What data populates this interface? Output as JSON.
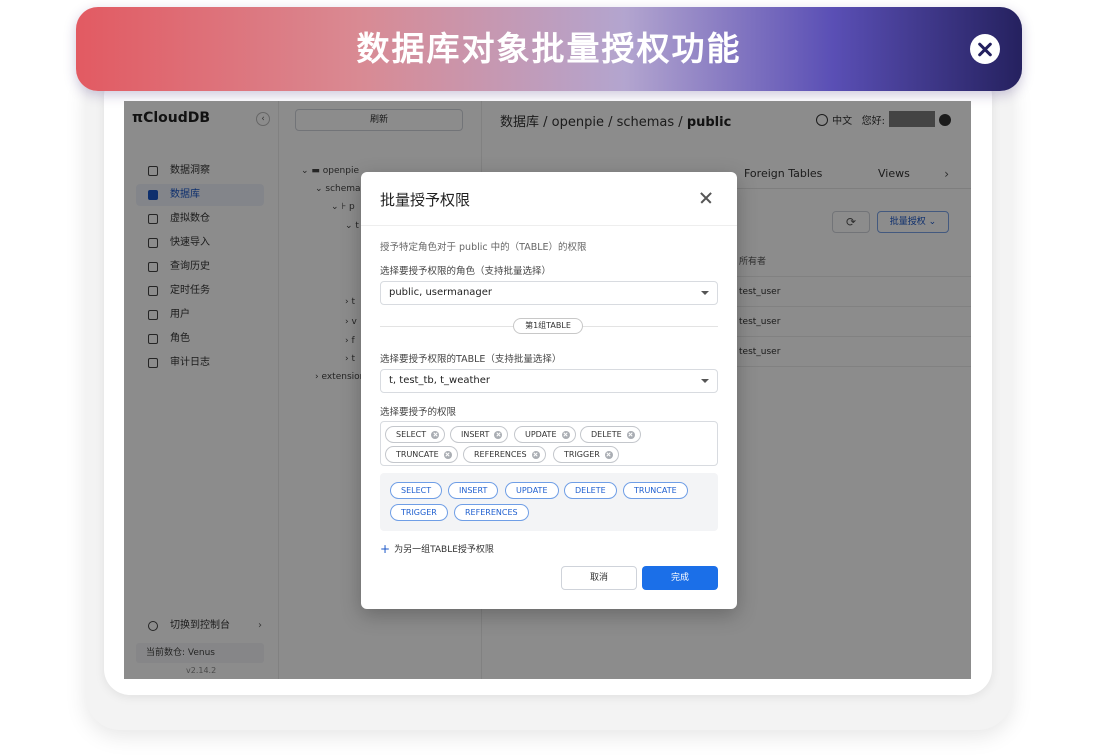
{
  "banner": {
    "title": "数据库对象批量授权功能"
  },
  "app": {
    "logo": "π",
    "logo_text": "CloudDB",
    "sidebar": {
      "items": [
        {
          "label": "数据洞察",
          "icon": "insight-icon"
        },
        {
          "label": "数据库",
          "icon": "database-icon"
        },
        {
          "label": "虚拟数仓",
          "icon": "warehouse-icon"
        },
        {
          "label": "快速导入",
          "icon": "upload-icon"
        },
        {
          "label": "查询历史",
          "icon": "history-icon"
        },
        {
          "label": "定时任务",
          "icon": "calendar-icon"
        },
        {
          "label": "用户",
          "icon": "user-icon"
        },
        {
          "label": "角色",
          "icon": "role-icon"
        },
        {
          "label": "审计日志",
          "icon": "audit-icon"
        }
      ],
      "switch_console": "切换到控制台",
      "current_warehouse": "当前数仓: Venus",
      "version": "v2.14.2"
    },
    "tree": {
      "refresh_label": "刷新",
      "rows": [
        "openpie",
        "schemas",
        "p",
        "t",
        "t",
        "v",
        "f",
        "t",
        "extensions"
      ]
    },
    "header": {
      "breadcrumb_1": "数据库 / openpie / schemas / ",
      "breadcrumb_current": "public",
      "language": "中文",
      "greeting": "您好:"
    },
    "tabs": [
      "Foreign Tables",
      "Views"
    ],
    "toolbar": {
      "batch_grant": "批量授权"
    },
    "table": {
      "owner_header": "所有者",
      "owners": [
        "test_user",
        "test_user",
        "test_user"
      ]
    }
  },
  "modal": {
    "title": "批量授予权限",
    "subtitle": "授予特定角色对于 public 中的（TABLE）的权限",
    "role_label": "选择要授予权限的角色（支持批量选择）",
    "role_value": "public, usermanager",
    "group_label": "第1组TABLE",
    "table_label": "选择要授予权限的TABLE（支持批量选择）",
    "table_value": "t, test_tb, t_weather",
    "perm_label": "选择要授予的权限",
    "selected_perms": [
      "SELECT",
      "INSERT",
      "UPDATE",
      "DELETE",
      "TRUNCATE",
      "REFERENCES",
      "TRIGGER"
    ],
    "options": [
      "SELECT",
      "INSERT",
      "UPDATE",
      "DELETE",
      "TRUNCATE",
      "TRIGGER",
      "REFERENCES"
    ],
    "add_group": "为另一组TABLE授予权限",
    "cancel": "取消",
    "ok": "完成"
  }
}
